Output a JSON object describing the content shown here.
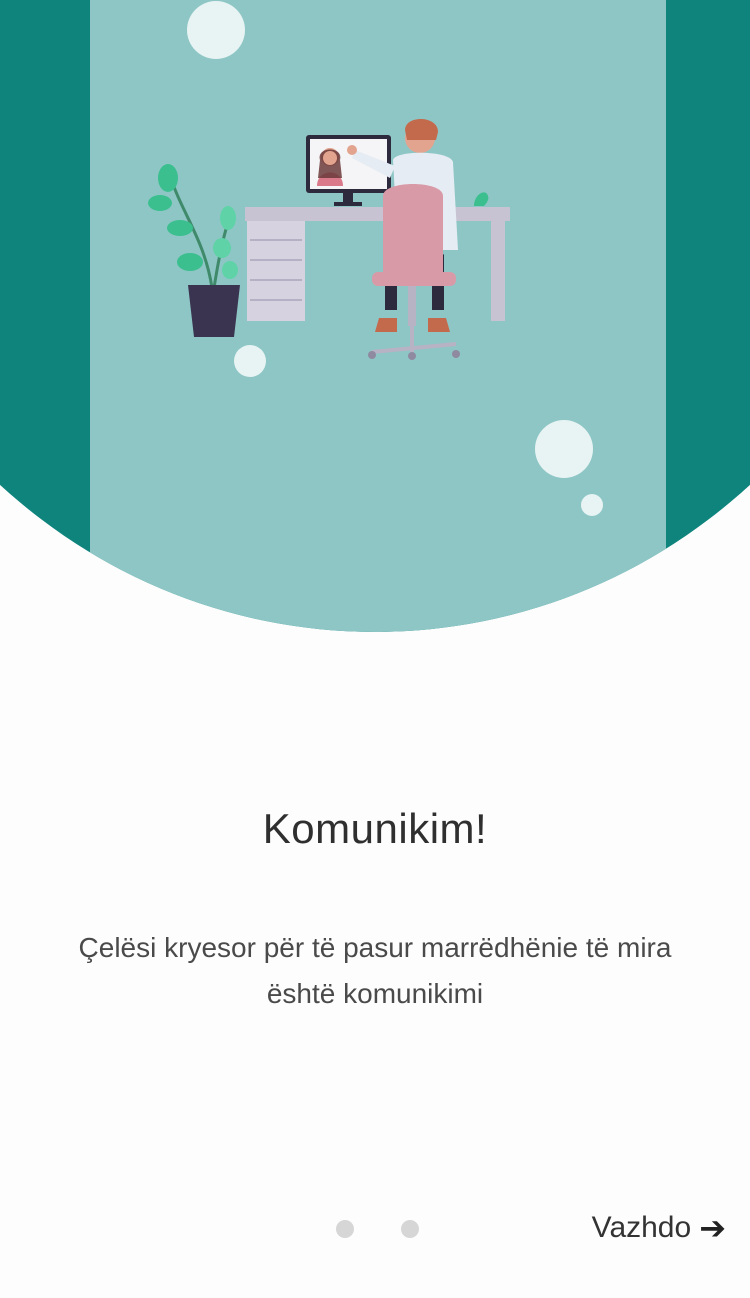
{
  "colors": {
    "teal_dark": "#0e847d",
    "teal_light": "#8ec6c6",
    "background": "#fdfdfd",
    "dot_inactive": "#d6d6d6"
  },
  "hero": {
    "illustration": "person-on-video-call-at-desk-illustration"
  },
  "content": {
    "title": "Komunikim!",
    "description": "Çelësi kryesor për të pasur marrëdhënie të mira është komunikimi"
  },
  "pager": {
    "dots": 2,
    "next_label": "Vazhdo",
    "next_icon": "arrow-right-icon"
  }
}
